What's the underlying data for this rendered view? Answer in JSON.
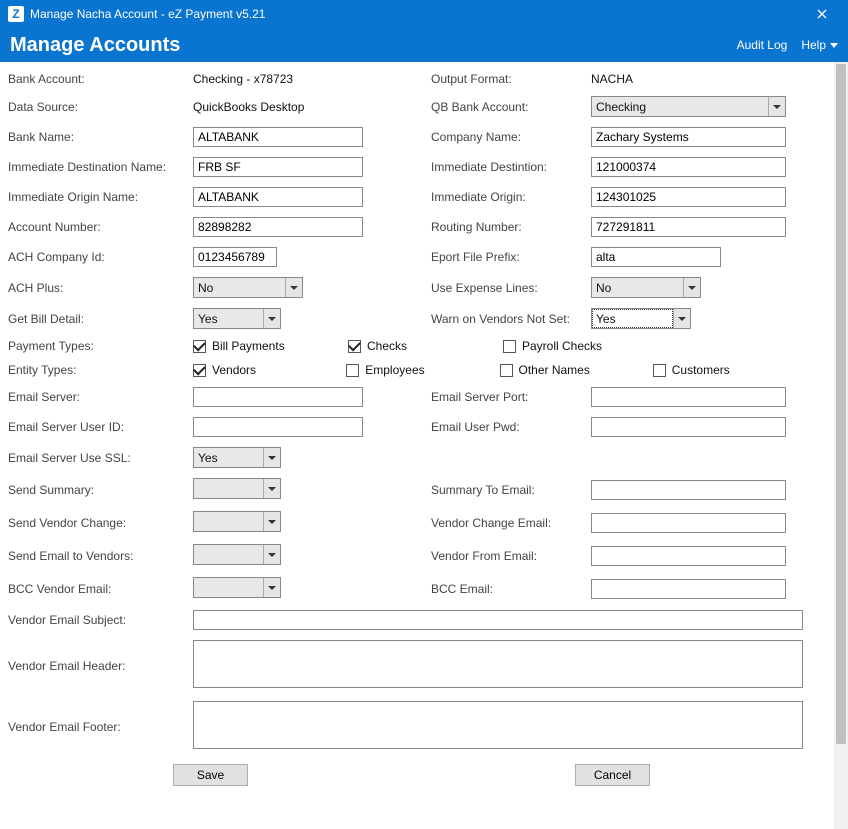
{
  "window": {
    "title": "Manage Nacha Account - eZ Payment v5.21",
    "heading": "Manage Accounts",
    "audit_log": "Audit Log",
    "help": "Help"
  },
  "labels": {
    "bank_account": "Bank Account:",
    "output_format": "Output Format:",
    "data_source": "Data Source:",
    "qb_bank_account": "QB Bank Account:",
    "bank_name": "Bank Name:",
    "company_name": "Company Name:",
    "immediate_dest_name": "Immediate Destination Name:",
    "immediate_destination": "Immediate Destintion:",
    "immediate_origin_name": "Immediate Origin Name:",
    "immediate_origin": "Immediate Origin:",
    "account_number": "Account Number:",
    "routing_number": "Routing Number:",
    "ach_company_id": "ACH Company Id:",
    "export_file_prefix": "Eport File Prefix:",
    "ach_plus": "ACH Plus:",
    "use_expense_lines": "Use Expense Lines:",
    "get_bill_detail": "Get Bill Detail:",
    "warn_vendors_not_set": "Warn on Vendors Not Set:",
    "payment_types": "Payment Types:",
    "entity_types": "Entity Types:",
    "email_server": "Email Server:",
    "email_server_port": "Email Server Port:",
    "email_server_user_id": "Email Server User ID:",
    "email_user_pwd": "Email User Pwd:",
    "email_server_use_ssl": "Email Server Use SSL:",
    "send_summary": "Send Summary:",
    "summary_to_email": "Summary To Email:",
    "send_vendor_change": "Send Vendor Change:",
    "vendor_change_email": "Vendor Change Email:",
    "send_email_to_vendors": "Send Email to Vendors:",
    "vendor_from_email": "Vendor From Email:",
    "bcc_vendor_email": "BCC Vendor Email:",
    "bcc_email": "BCC Email:",
    "vendor_email_subject": "Vendor Email Subject:",
    "vendor_email_header": "Vendor Email Header:",
    "vendor_email_footer": "Vendor Email Footer:"
  },
  "values": {
    "bank_account": "Checking - x78723",
    "output_format": "NACHA",
    "data_source": "QuickBooks Desktop",
    "qb_bank_account": "Checking",
    "bank_name": "ALTABANK",
    "company_name": "Zachary Systems",
    "immediate_dest_name": "FRB SF",
    "immediate_destination": "121000374",
    "immediate_origin_name": "ALTABANK",
    "immediate_origin": "124301025",
    "account_number": "82898282",
    "routing_number": "727291811",
    "ach_company_id": "0123456789",
    "export_file_prefix": "alta",
    "ach_plus": "No",
    "use_expense_lines": "No",
    "get_bill_detail": "Yes",
    "warn_vendors_not_set": "Yes",
    "email_server": "",
    "email_server_port": "",
    "email_server_user_id": "",
    "email_user_pwd": "",
    "email_server_use_ssl": "Yes",
    "send_summary": "",
    "summary_to_email": "",
    "send_vendor_change": "",
    "vendor_change_email": "",
    "send_email_to_vendors": "",
    "vendor_from_email": "",
    "bcc_vendor_email": "",
    "bcc_email": "",
    "vendor_email_subject": "",
    "vendor_email_header": "",
    "vendor_email_footer": ""
  },
  "checkboxes": {
    "payment": {
      "bill_payments": {
        "label": "Bill Payments",
        "checked": true
      },
      "checks": {
        "label": "Checks",
        "checked": true
      },
      "payroll_checks": {
        "label": "Payroll Checks",
        "checked": false
      }
    },
    "entity": {
      "vendors": {
        "label": "Vendors",
        "checked": true
      },
      "employees": {
        "label": "Employees",
        "checked": false
      },
      "other_names": {
        "label": "Other Names",
        "checked": false
      },
      "customers": {
        "label": "Customers",
        "checked": false
      }
    }
  },
  "buttons": {
    "save": "Save",
    "cancel": "Cancel"
  }
}
